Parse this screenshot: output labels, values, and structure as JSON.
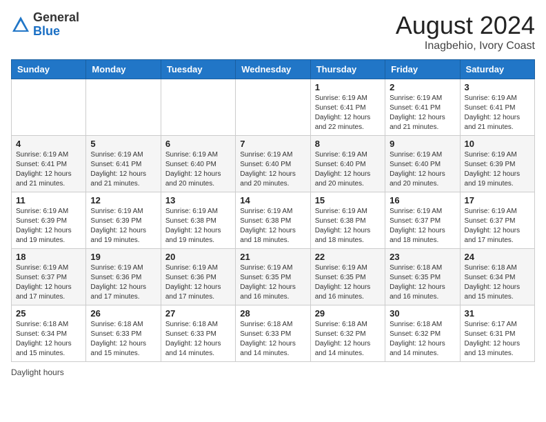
{
  "header": {
    "logo_general": "General",
    "logo_blue": "Blue",
    "month_year": "August 2024",
    "location": "Inagbehio, Ivory Coast"
  },
  "days_of_week": [
    "Sunday",
    "Monday",
    "Tuesday",
    "Wednesday",
    "Thursday",
    "Friday",
    "Saturday"
  ],
  "footer": {
    "daylight_hours": "Daylight hours"
  },
  "weeks": [
    [
      {
        "day": "",
        "detail": ""
      },
      {
        "day": "",
        "detail": ""
      },
      {
        "day": "",
        "detail": ""
      },
      {
        "day": "",
        "detail": ""
      },
      {
        "day": "1",
        "detail": "Sunrise: 6:19 AM\nSunset: 6:41 PM\nDaylight: 12 hours\nand 22 minutes."
      },
      {
        "day": "2",
        "detail": "Sunrise: 6:19 AM\nSunset: 6:41 PM\nDaylight: 12 hours\nand 21 minutes."
      },
      {
        "day": "3",
        "detail": "Sunrise: 6:19 AM\nSunset: 6:41 PM\nDaylight: 12 hours\nand 21 minutes."
      }
    ],
    [
      {
        "day": "4",
        "detail": "Sunrise: 6:19 AM\nSunset: 6:41 PM\nDaylight: 12 hours\nand 21 minutes."
      },
      {
        "day": "5",
        "detail": "Sunrise: 6:19 AM\nSunset: 6:41 PM\nDaylight: 12 hours\nand 21 minutes."
      },
      {
        "day": "6",
        "detail": "Sunrise: 6:19 AM\nSunset: 6:40 PM\nDaylight: 12 hours\nand 20 minutes."
      },
      {
        "day": "7",
        "detail": "Sunrise: 6:19 AM\nSunset: 6:40 PM\nDaylight: 12 hours\nand 20 minutes."
      },
      {
        "day": "8",
        "detail": "Sunrise: 6:19 AM\nSunset: 6:40 PM\nDaylight: 12 hours\nand 20 minutes."
      },
      {
        "day": "9",
        "detail": "Sunrise: 6:19 AM\nSunset: 6:40 PM\nDaylight: 12 hours\nand 20 minutes."
      },
      {
        "day": "10",
        "detail": "Sunrise: 6:19 AM\nSunset: 6:39 PM\nDaylight: 12 hours\nand 19 minutes."
      }
    ],
    [
      {
        "day": "11",
        "detail": "Sunrise: 6:19 AM\nSunset: 6:39 PM\nDaylight: 12 hours\nand 19 minutes."
      },
      {
        "day": "12",
        "detail": "Sunrise: 6:19 AM\nSunset: 6:39 PM\nDaylight: 12 hours\nand 19 minutes."
      },
      {
        "day": "13",
        "detail": "Sunrise: 6:19 AM\nSunset: 6:38 PM\nDaylight: 12 hours\nand 19 minutes."
      },
      {
        "day": "14",
        "detail": "Sunrise: 6:19 AM\nSunset: 6:38 PM\nDaylight: 12 hours\nand 18 minutes."
      },
      {
        "day": "15",
        "detail": "Sunrise: 6:19 AM\nSunset: 6:38 PM\nDaylight: 12 hours\nand 18 minutes."
      },
      {
        "day": "16",
        "detail": "Sunrise: 6:19 AM\nSunset: 6:37 PM\nDaylight: 12 hours\nand 18 minutes."
      },
      {
        "day": "17",
        "detail": "Sunrise: 6:19 AM\nSunset: 6:37 PM\nDaylight: 12 hours\nand 17 minutes."
      }
    ],
    [
      {
        "day": "18",
        "detail": "Sunrise: 6:19 AM\nSunset: 6:37 PM\nDaylight: 12 hours\nand 17 minutes."
      },
      {
        "day": "19",
        "detail": "Sunrise: 6:19 AM\nSunset: 6:36 PM\nDaylight: 12 hours\nand 17 minutes."
      },
      {
        "day": "20",
        "detail": "Sunrise: 6:19 AM\nSunset: 6:36 PM\nDaylight: 12 hours\nand 17 minutes."
      },
      {
        "day": "21",
        "detail": "Sunrise: 6:19 AM\nSunset: 6:35 PM\nDaylight: 12 hours\nand 16 minutes."
      },
      {
        "day": "22",
        "detail": "Sunrise: 6:19 AM\nSunset: 6:35 PM\nDaylight: 12 hours\nand 16 minutes."
      },
      {
        "day": "23",
        "detail": "Sunrise: 6:18 AM\nSunset: 6:35 PM\nDaylight: 12 hours\nand 16 minutes."
      },
      {
        "day": "24",
        "detail": "Sunrise: 6:18 AM\nSunset: 6:34 PM\nDaylight: 12 hours\nand 15 minutes."
      }
    ],
    [
      {
        "day": "25",
        "detail": "Sunrise: 6:18 AM\nSunset: 6:34 PM\nDaylight: 12 hours\nand 15 minutes."
      },
      {
        "day": "26",
        "detail": "Sunrise: 6:18 AM\nSunset: 6:33 PM\nDaylight: 12 hours\nand 15 minutes."
      },
      {
        "day": "27",
        "detail": "Sunrise: 6:18 AM\nSunset: 6:33 PM\nDaylight: 12 hours\nand 14 minutes."
      },
      {
        "day": "28",
        "detail": "Sunrise: 6:18 AM\nSunset: 6:33 PM\nDaylight: 12 hours\nand 14 minutes."
      },
      {
        "day": "29",
        "detail": "Sunrise: 6:18 AM\nSunset: 6:32 PM\nDaylight: 12 hours\nand 14 minutes."
      },
      {
        "day": "30",
        "detail": "Sunrise: 6:18 AM\nSunset: 6:32 PM\nDaylight: 12 hours\nand 14 minutes."
      },
      {
        "day": "31",
        "detail": "Sunrise: 6:17 AM\nSunset: 6:31 PM\nDaylight: 12 hours\nand 13 minutes."
      }
    ]
  ]
}
